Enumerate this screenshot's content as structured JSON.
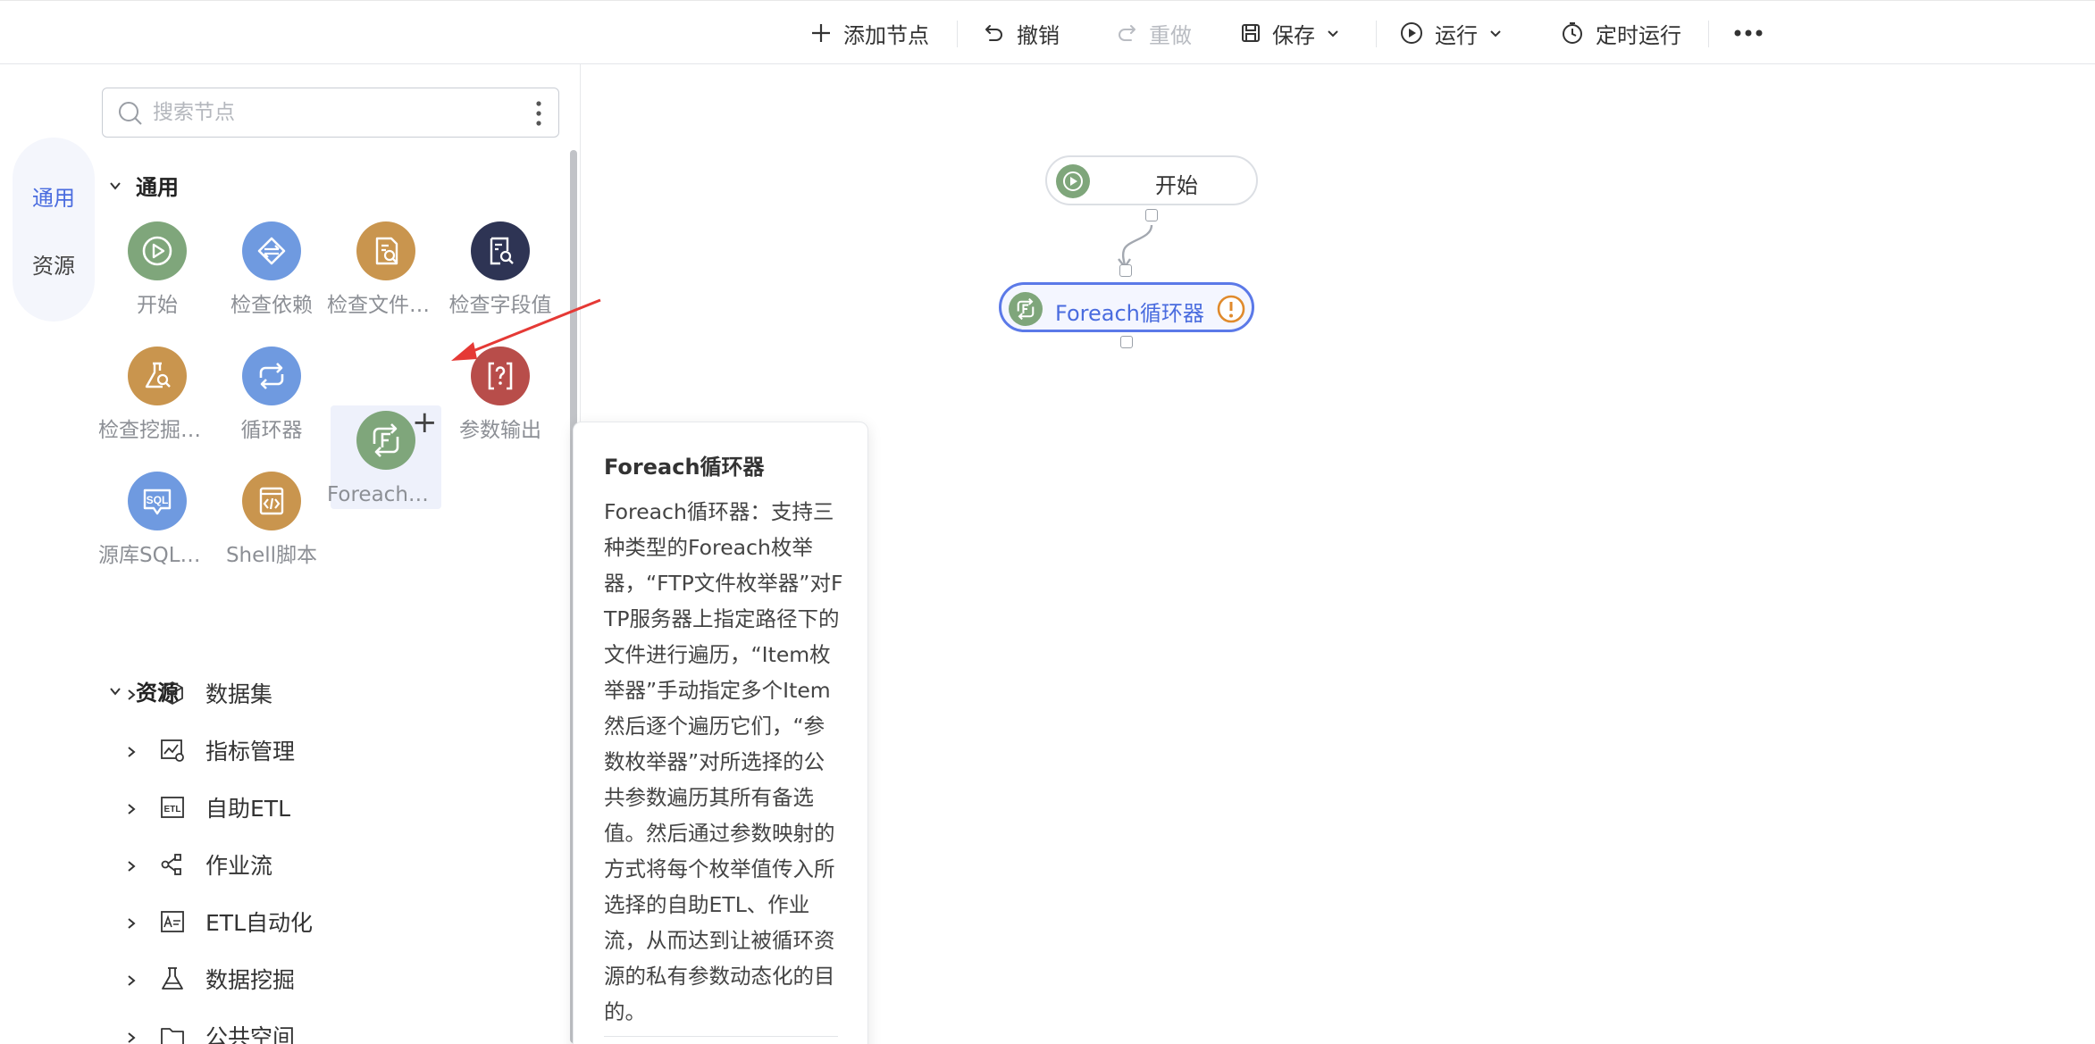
{
  "toolbar": {
    "add_node": "添加节点",
    "undo": "撤销",
    "redo": "重做",
    "save": "保存",
    "run": "运行",
    "schedule": "定时运行"
  },
  "tabs": {
    "general": "通用",
    "resources": "资源"
  },
  "search": {
    "placeholder": "搜索节点"
  },
  "sections": {
    "general": "通用",
    "resources": "资源"
  },
  "nodes": [
    {
      "label": "开始",
      "color": "#7fa67b",
      "icon": "play-icon"
    },
    {
      "label": "检查依赖",
      "color": "#6f9ae0",
      "icon": "dependency-icon"
    },
    {
      "label": "检查文件是否存在",
      "color": "#c9954e",
      "icon": "file-check-icon"
    },
    {
      "label": "检查字段值",
      "color": "#2e3454",
      "icon": "field-check-icon"
    },
    {
      "label": "检查挖掘模型",
      "color": "#c9954e",
      "icon": "flask-icon"
    },
    {
      "label": "循环器",
      "color": "#6f9ae0",
      "icon": "loop-icon"
    },
    {
      "label": "Foreach循环器",
      "color": "#7fa67b",
      "icon": "foreach-icon"
    },
    {
      "label": "参数输出",
      "color": "#b84d4a",
      "icon": "param-output-icon"
    },
    {
      "label": "源库SQL脚本",
      "color": "#6f9ae0",
      "icon": "sql-icon"
    },
    {
      "label": "Shell脚本",
      "color": "#c9954e",
      "icon": "shell-icon"
    }
  ],
  "resources": [
    {
      "label": "数据集",
      "icon": "cube-icon"
    },
    {
      "label": "指标管理",
      "icon": "metric-icon"
    },
    {
      "label": "自助ETL",
      "icon": "etl-icon"
    },
    {
      "label": "作业流",
      "icon": "workflow-icon"
    },
    {
      "label": "ETL自动化",
      "icon": "etl-auto-icon"
    },
    {
      "label": "数据挖掘",
      "icon": "mining-icon"
    },
    {
      "label": "公共空间",
      "icon": "folder-icon"
    }
  ],
  "canvas": {
    "start_label": "开始",
    "foreach_label": "Foreach循环器"
  },
  "tooltip": {
    "title": "Foreach循环器",
    "body": "Foreach循环器：支持三种类型的Foreach枚举器，“FTP文件枚举器”对FTP服务器上指定路径下的文件进行遍历，“Item枚举器”手动指定多个Item然后逐个遍历它们，“参数枚举器”对所选择的公共参数遍历其所有备选值。然后通过参数映射的方式将每个枚举值传入所选择的自助ETL、作业流，从而达到让被循环资源的私有参数动态化的目的。"
  },
  "colors": {
    "accent": "#4a6cdf",
    "annotation_arrow": "#e53935",
    "warning": "#e08a2c"
  }
}
